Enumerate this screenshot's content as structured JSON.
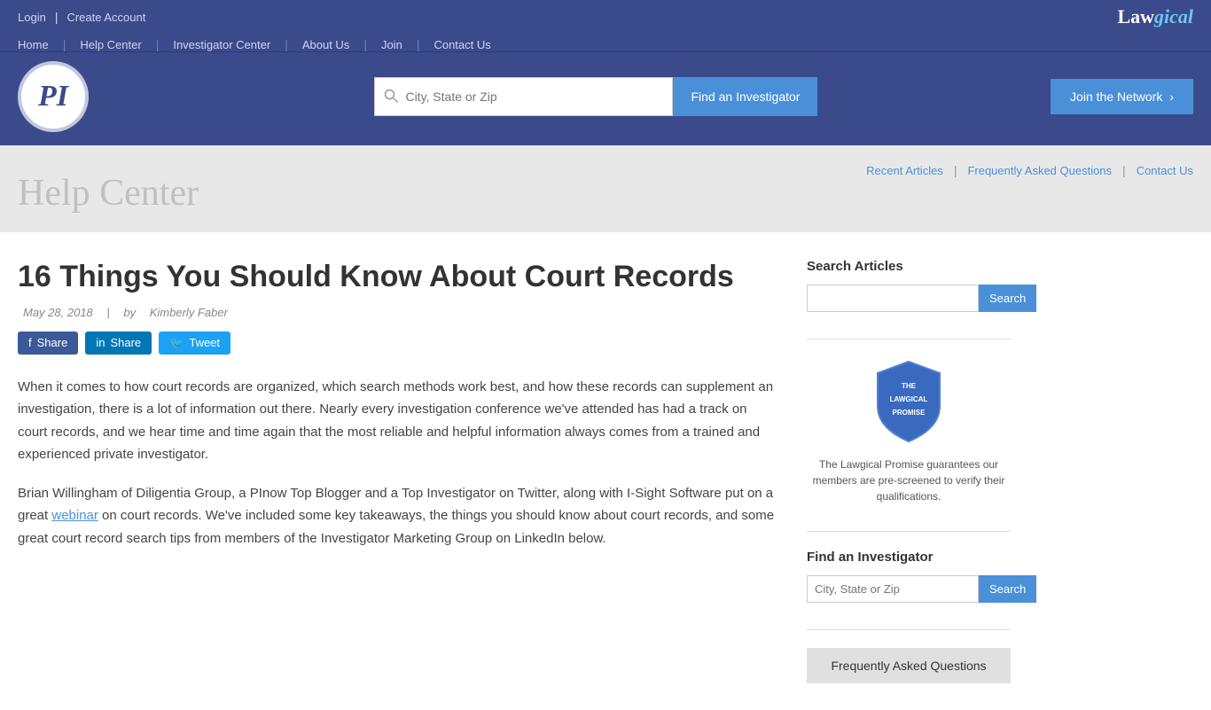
{
  "topbar": {
    "login_label": "Login",
    "create_account_label": "Create Account",
    "logo_law": "Law",
    "logo_gical": "gical"
  },
  "header": {
    "nav": {
      "home": "Home",
      "help_center": "Help Center",
      "investigator_center": "Investigator Center",
      "about_us": "About Us",
      "join": "Join",
      "contact_us": "Contact Us"
    },
    "search_placeholder": "City, State or Zip",
    "find_btn": "Find an Investigator",
    "join_btn": "Join the Network"
  },
  "help_banner": {
    "title": "Help Center",
    "nav": {
      "recent_articles": "Recent Articles",
      "faq": "Frequently Asked Questions",
      "contact_us": "Contact Us"
    }
  },
  "article": {
    "title": "16 Things You Should Know About Court Records",
    "date": "May 28, 2018",
    "author": "Kimberly Faber",
    "share_fb": "Share",
    "share_in": "Share",
    "share_tw": "Tweet",
    "para1": "When it comes to how court records are organized, which search methods work best, and how these records can supplement an investigation, there is a lot of information out there. Nearly every investigation conference we've attended has had a track on court records, and we hear time and time again that the most reliable and helpful information always comes from a trained and experienced private investigator.",
    "para2_part1": "Brian Willingham of Diligentia Group, a PInow Top Blogger and a Top Investigator on Twitter, along with I-Sight Software put on a great ",
    "para2_link": "webinar",
    "para2_part2": " on court records. We've included some key takeaways, the things you should know about court records, and some great court record search tips from members of the Investigator Marketing Group on LinkedIn below."
  },
  "sidebar": {
    "search_title": "Search Articles",
    "search_placeholder": "",
    "search_btn": "Search",
    "promise_text": "The Lawgical Promise guarantees our members are pre-screened to verify their qualifications.",
    "find_title": "Find an Investigator",
    "find_placeholder": "City, State or Zip",
    "find_btn": "Search",
    "faq_btn": "Frequently Asked Questions",
    "promise_badge": {
      "line1": "THE",
      "line2": "LAWGICAL",
      "line3": "PROMISE"
    }
  }
}
